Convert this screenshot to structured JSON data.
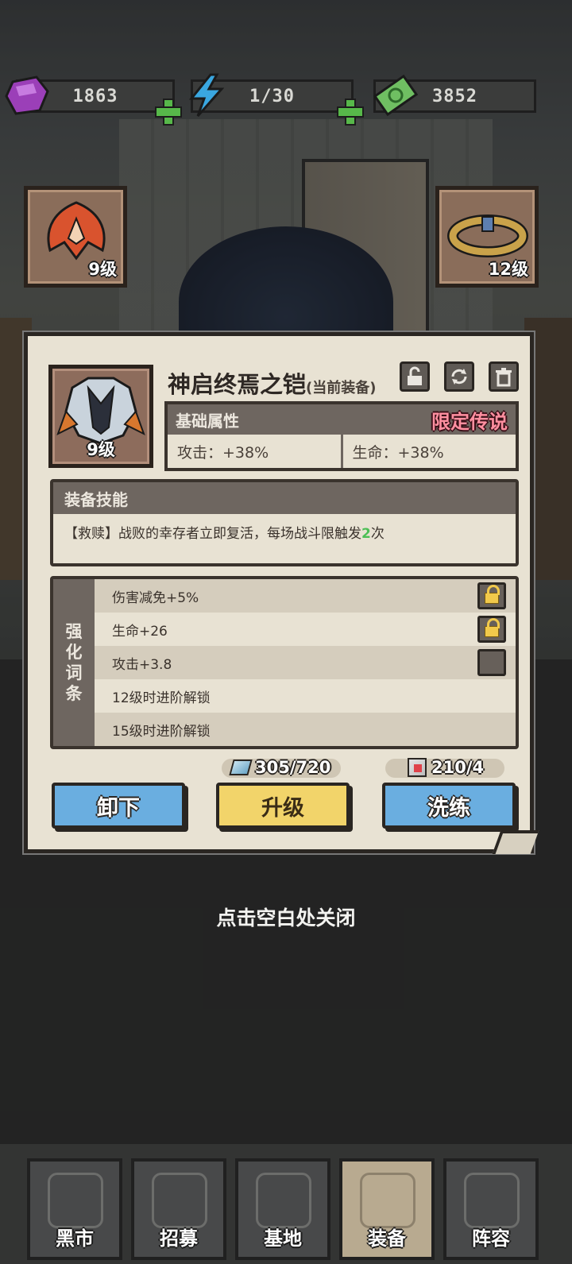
{
  "resources": {
    "gems": "1863",
    "energy": "1/30",
    "cash": "3852"
  },
  "side_slots": {
    "left_level": "9级",
    "right_level": "12级"
  },
  "item": {
    "level": "9级",
    "name": "神启终焉之铠",
    "status": "(当前装备)",
    "basic_title": "基础属性",
    "rarity": "限定传说",
    "attack": "攻击：+38%",
    "hp": "生命：+38%"
  },
  "skill": {
    "title": "装备技能",
    "text_prefix": "【救赎】战败的幸存者立即复活，每场战斗限触发",
    "count": "2",
    "text_suffix": "次"
  },
  "enhance": {
    "side_label": [
      "强",
      "化",
      "词",
      "条"
    ],
    "rows": [
      {
        "text": "伤害减免+5%",
        "control": "lock"
      },
      {
        "text": "生命+26",
        "control": "lock"
      },
      {
        "text": "攻击+3.8",
        "control": "box"
      },
      {
        "text": "12级时进阶解锁",
        "control": "none"
      },
      {
        "text": "15级时进阶解锁",
        "control": "none"
      }
    ]
  },
  "costs": {
    "crystal": "305/720",
    "cube": "210/4"
  },
  "buttons": {
    "unequip": "卸下",
    "upgrade": "升级",
    "reforge": "洗练"
  },
  "close_hint": "点击空白处关闭",
  "nav": {
    "items": [
      "黑市",
      "招募",
      "基地",
      "装备",
      "阵容"
    ],
    "active_index": 3
  },
  "colors": {
    "blue_button": "#6aaee0",
    "yellow_button": "#f2d46a",
    "legend_pink": "#ff8fa0",
    "green_plus": "#57b84a"
  }
}
